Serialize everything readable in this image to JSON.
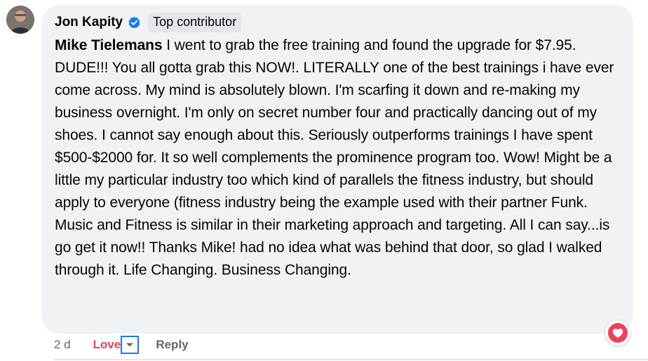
{
  "comment": {
    "author": "Jon Kapity",
    "badge": "Top contributor",
    "mention": "Mike Tielemans",
    "text": " I went to grab the free training and found the upgrade for $7.95. DUDE!!! You all gotta grab this NOW!. LITERALLY one of the best trainings i have ever come across. My mind is absolutely blown. I'm scarfing it down and re-making my business overnight. I'm only on secret number four and practically dancing out of my shoes. I cannot say enough about this. Seriously outperforms trainings I have spent $500-$2000 for. It so well complements the prominence program too. Wow! Might be a little my particular industry too which kind of parallels the fitness industry, but should apply to everyone (fitness industry being the example used with their partner Funk. Music and Fitness is similar in their marketing approach and targeting. All I can say...is go get it now!! Thanks Mike! had no idea what was behind that door, so glad I walked through it. Life Changing. Business Changing."
  },
  "actions": {
    "timestamp": "2 d",
    "love_label": "Love",
    "reply_label": "Reply"
  },
  "colors": {
    "love": "#f33e58",
    "verified": "#1877f2",
    "bubble": "#f0f2f5"
  },
  "icons": {
    "verified": "verified-check-icon",
    "dropdown": "chevron-down-icon",
    "reaction": "heart-icon"
  }
}
